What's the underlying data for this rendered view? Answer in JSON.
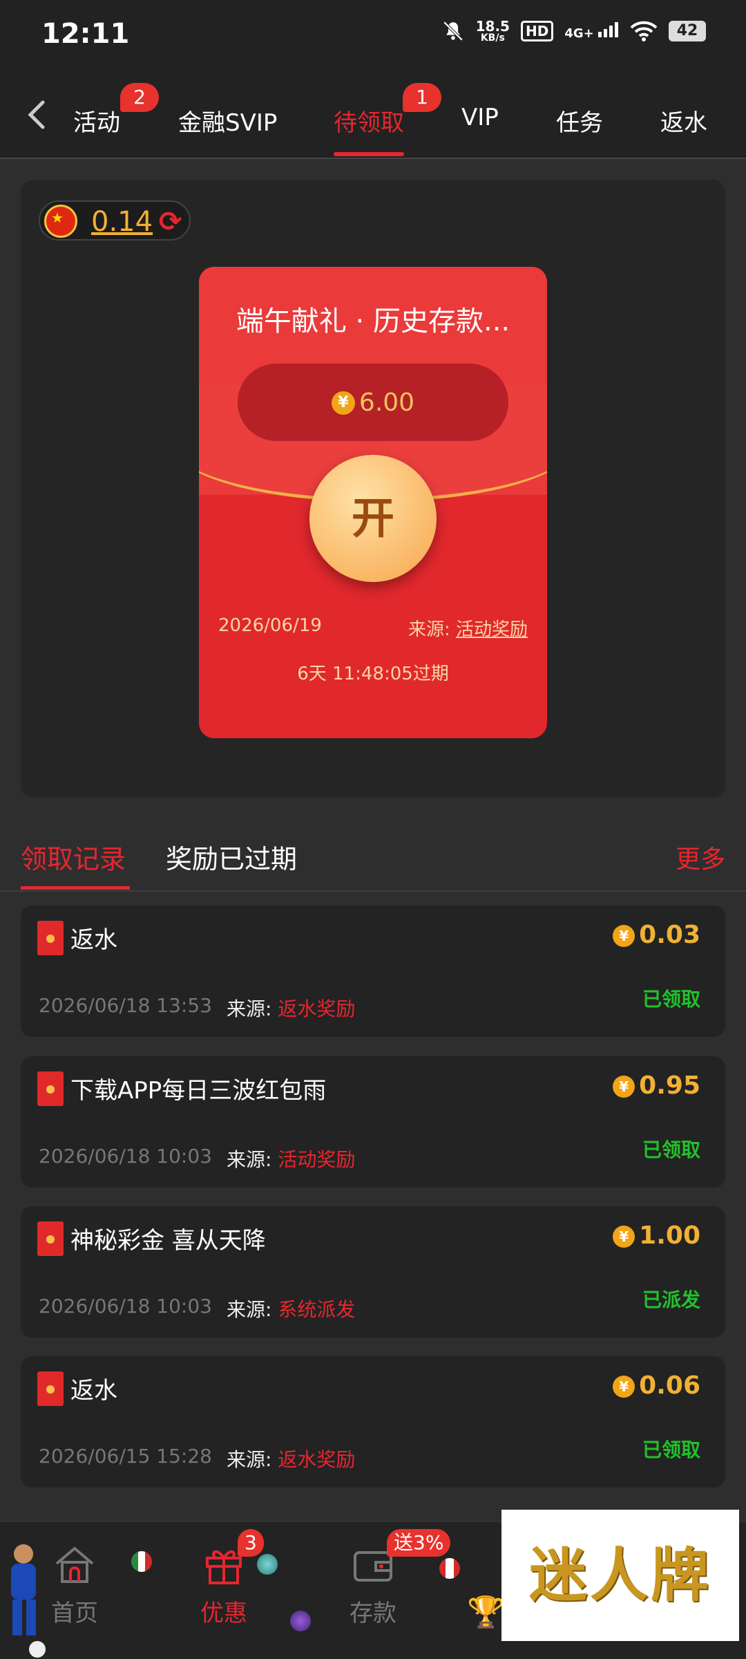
{
  "status_bar": {
    "time": "12:11",
    "speed_value": "18.5",
    "speed_unit": "KB/s",
    "hd_label": "HD",
    "network_label": "4G+",
    "battery": "42",
    "icons": [
      "mute-bell-icon",
      "signal-icon",
      "wifi-icon",
      "battery-icon"
    ]
  },
  "nav": {
    "tabs": [
      {
        "label": "活动",
        "badge": "2"
      },
      {
        "label": "金融SVIP"
      },
      {
        "label": "待领取",
        "badge": "1",
        "active": true
      },
      {
        "label": "VIP"
      },
      {
        "label": "任务"
      },
      {
        "label": "返水"
      }
    ]
  },
  "balance": {
    "value": "0.14",
    "flag": "china-flag-icon",
    "refresh_icon": "refresh-icon"
  },
  "envelope": {
    "title": "端午献礼 · 历史存款...",
    "currency_symbol": "¥",
    "amount": "6.00",
    "open_label": "开",
    "date": "2026/06/19",
    "source_label": "来源:",
    "source_value": "活动奖励",
    "expire_text": "6天 11:48:05过期"
  },
  "record_tabs": {
    "tab1": "领取记录",
    "tab2": "奖励已过期",
    "more": "更多"
  },
  "records": [
    {
      "title": "返水",
      "amount": "0.03",
      "date": "2026/06/18 13:53",
      "source_label": "来源:",
      "source": "返水奖励",
      "status": "已领取"
    },
    {
      "title": "下载APP每日三波红包雨",
      "amount": "0.95",
      "date": "2026/06/18 10:03",
      "source_label": "来源:",
      "source": "活动奖励",
      "status": "已领取"
    },
    {
      "title": "神秘彩金 喜从天降",
      "amount": "1.00",
      "date": "2026/06/18 10:03",
      "source_label": "来源:",
      "source": "系统派发",
      "status": "已派发"
    },
    {
      "title": "返水",
      "amount": "0.06",
      "date": "2026/06/15 15:28",
      "source_label": "来源:",
      "source": "返水奖励",
      "status": "已领取"
    }
  ],
  "bottom_nav": {
    "items": [
      {
        "label": "首页",
        "icon": "home-icon"
      },
      {
        "label": "优惠",
        "icon": "gift-icon",
        "badge": "3",
        "active": true
      },
      {
        "label": "存款",
        "icon": "wallet-icon",
        "badge": "送3%"
      }
    ]
  },
  "brand": {
    "text": "迷人牌"
  },
  "colors": {
    "accent_red": "#e6262e",
    "gold": "#f2b134",
    "success_green": "#21c22a",
    "background": "#2e2e2e"
  }
}
